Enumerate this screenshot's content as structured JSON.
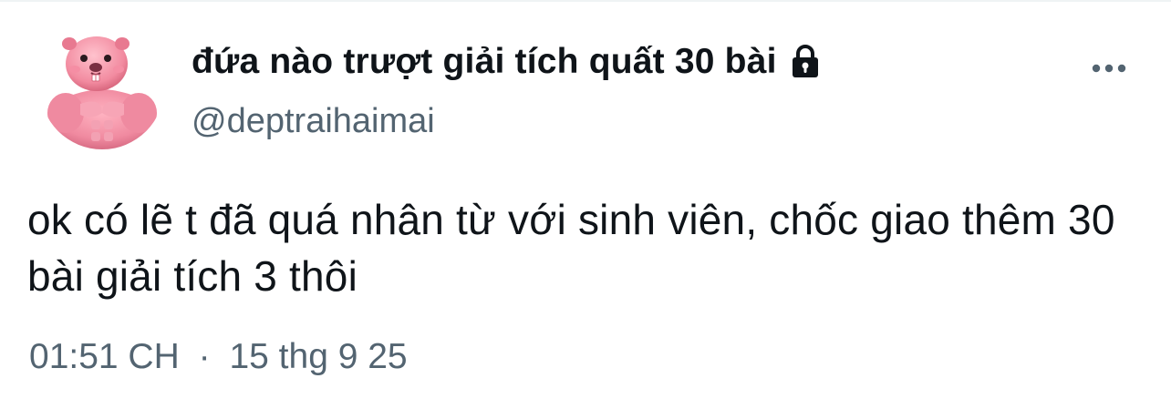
{
  "tweet": {
    "display_name": "đứa nào trượt giải tích quất 30 bài",
    "handle": "@deptraihaimai",
    "text": "ok có lẽ t đã quá nhân từ với sinh viên, chốc giao thêm 30 bài giải tích 3 thôi",
    "time": "01:51 CH",
    "separator": "·",
    "date": "15 thg 9 25",
    "protected_icon": "lock-icon",
    "menu_icon": "more-options-icon",
    "avatar_icon": "pink-muscle-beaver-avatar"
  },
  "colors": {
    "text": "#0f1419",
    "secondary_text": "#536471",
    "background": "#ffffff",
    "avatar_pink": "#f28ba0"
  }
}
